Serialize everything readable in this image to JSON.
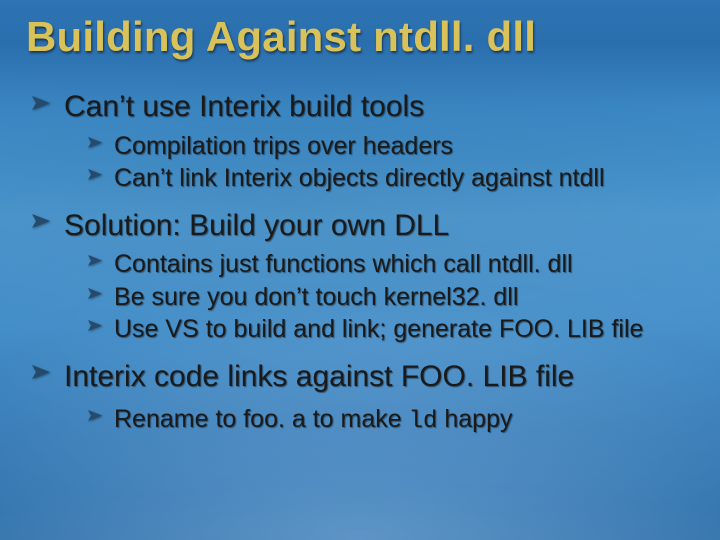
{
  "title": "Building Against ntdll. dll",
  "bullets": {
    "b1": "Can’t use Interix build tools",
    "b1a": "Compilation trips over headers",
    "b1b": "Can’t link Interix objects directly against ntdll",
    "b2": "Solution: Build your own DLL",
    "b2a": "Contains just functions which call ntdll. dll",
    "b2b": "Be sure you don’t touch kernel32. dll",
    "b2c": "Use VS to build and link; generate FOO. LIB file",
    "b3": "Interix code links against FOO. LIB file",
    "b3a_pre": "Rename to foo. a to make ",
    "b3a_code": "ld",
    "b3a_post": " happy"
  }
}
